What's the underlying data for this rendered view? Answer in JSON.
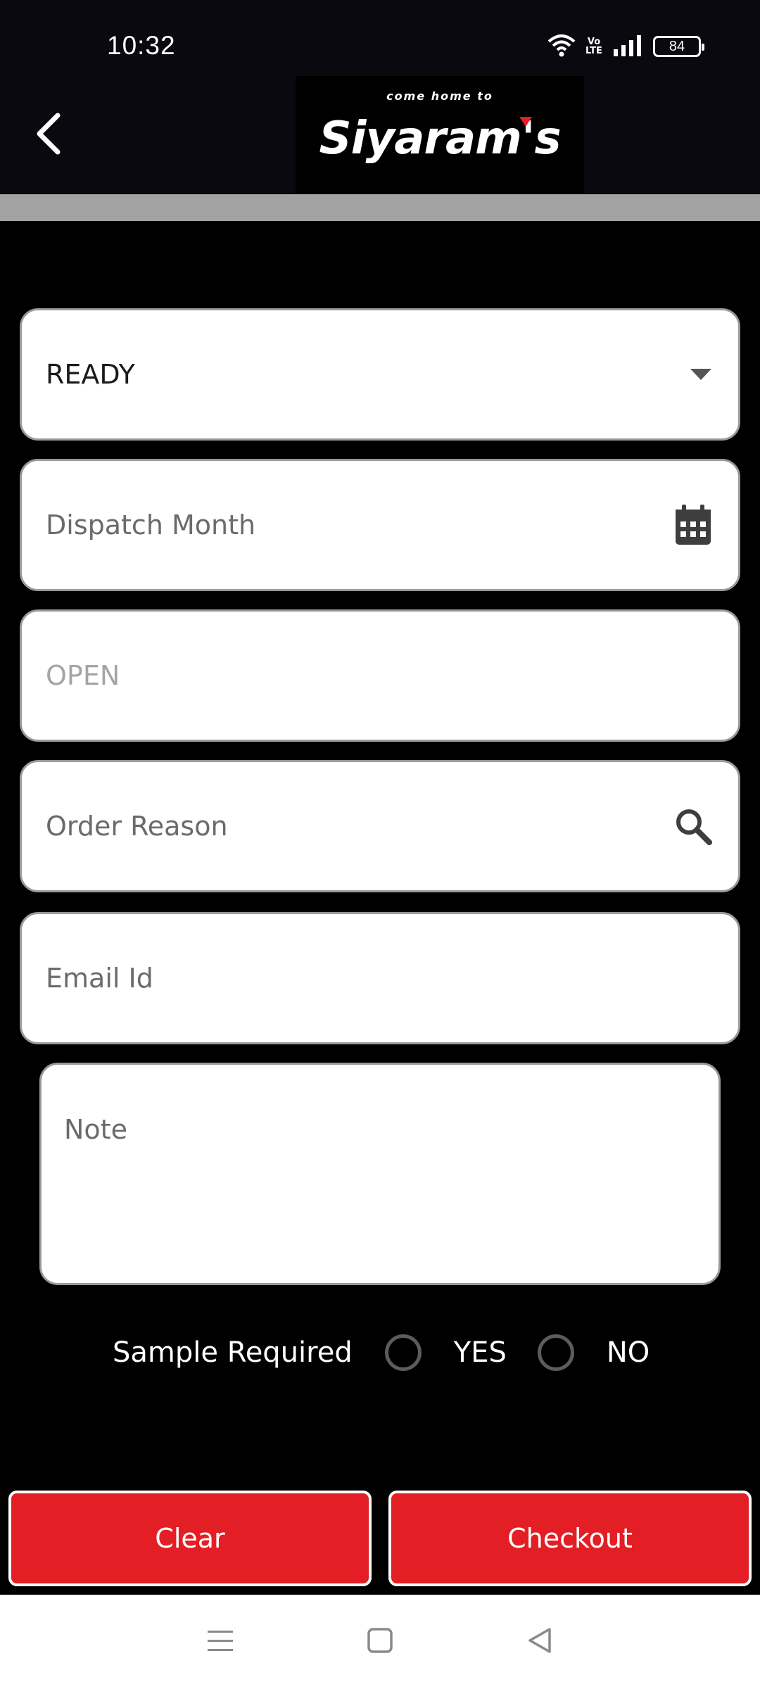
{
  "status_bar": {
    "time": "10:32",
    "network_label": "Vo LTE",
    "battery": "84"
  },
  "header": {
    "logo_tagline": "come home to",
    "logo_name": "Siyaram's",
    "back_icon": "chevron-left-icon",
    "brand_color": "#e31e24"
  },
  "form": {
    "status_select": {
      "value": "READY",
      "icon": "caret-down-icon"
    },
    "dispatch_month": {
      "placeholder": "Dispatch Month",
      "icon": "calendar-icon"
    },
    "order_status": {
      "value": "OPEN"
    },
    "order_reason": {
      "placeholder": "Order Reason",
      "icon": "search-icon"
    },
    "email": {
      "placeholder": "Email Id"
    },
    "note": {
      "placeholder": "Note"
    },
    "sample_required": {
      "label": "Sample Required",
      "options": [
        "YES",
        "NO"
      ]
    }
  },
  "actions": {
    "clear_label": "Clear",
    "checkout_label": "Checkout"
  },
  "nav": {
    "menu_icon": "menu-icon",
    "home_icon": "home-square-icon",
    "back_icon": "back-triangle-icon"
  }
}
